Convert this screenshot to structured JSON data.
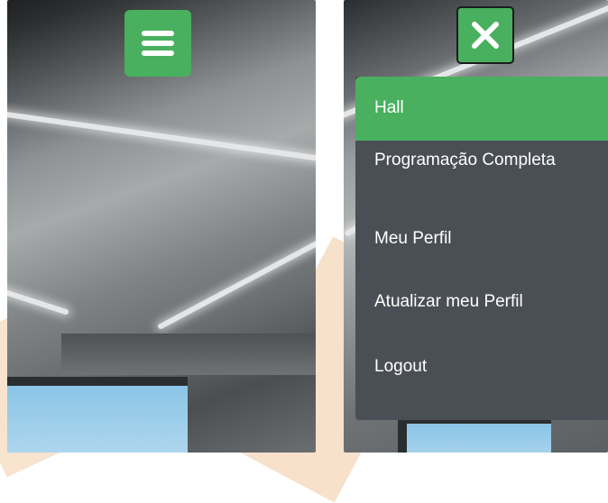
{
  "left_panel": {
    "menu_button_icon": "hamburger-menu-icon"
  },
  "right_panel": {
    "close_button_icon": "close-icon",
    "menu_items": [
      {
        "label": "Hall",
        "active": true
      },
      {
        "label": "Programação Completa",
        "active": false
      },
      {
        "label": "Meu Perfil",
        "active": false
      },
      {
        "label": "Atualizar meu Perfil",
        "active": false
      },
      {
        "label": "Logout",
        "active": false
      }
    ]
  },
  "colors": {
    "accent_green": "#48b05e",
    "menu_background": "#4a4f55",
    "menu_text": "#ffffff"
  }
}
